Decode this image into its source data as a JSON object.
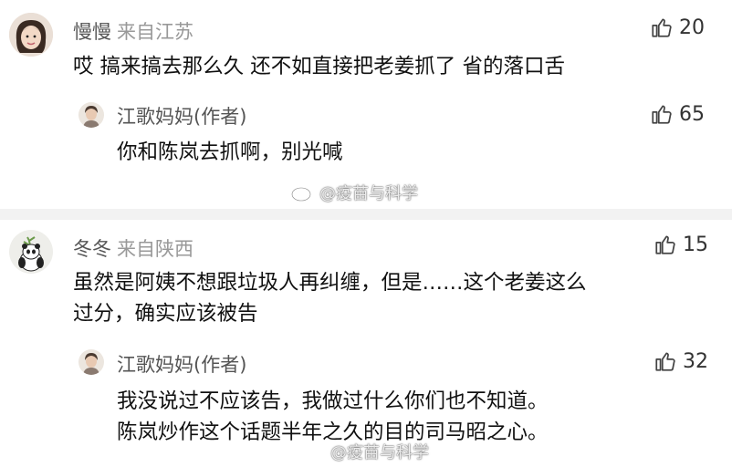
{
  "comments": [
    {
      "user": "慢慢",
      "location": "来自江苏",
      "likes": "20",
      "lines": [
        "哎  搞来搞去那么久  还不如直接把老姜抓了  省的落口舌"
      ],
      "reply": {
        "user": "江歌妈妈(作者)",
        "likes": "65",
        "lines": [
          "你和陈岚去抓啊，别光喊"
        ]
      }
    },
    {
      "user": "冬冬",
      "location": "来自陕西",
      "likes": "15",
      "lines": [
        "虽然是阿姨不想跟垃圾人再纠缠，但是……这个老姜这么",
        "过分，确实应该被告"
      ],
      "reply": {
        "user": "江歌妈妈(作者)",
        "likes": "32",
        "lines": [
          "我没说过不应该告，我做过什么你们也不知道。",
          "陈岚炒作这个话题半年之久的目的司马昭之心。"
        ]
      }
    }
  ],
  "watermark": "@疫苗与科学",
  "icons": {
    "like": "thumbs-up-icon",
    "weibo": "weibo-logo-icon"
  }
}
